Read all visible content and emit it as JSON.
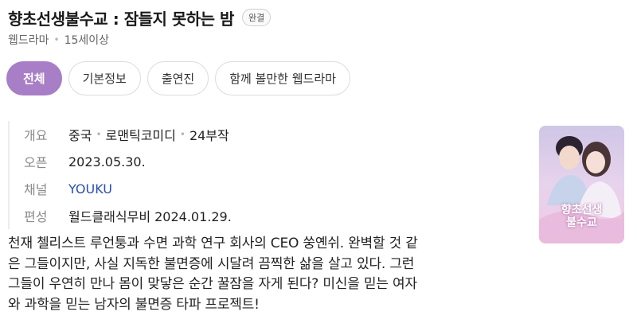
{
  "header": {
    "title": "향초선생불수교 : 잠들지 못하는 밤",
    "badge": "완결",
    "genre": "웹드라마",
    "rating": "15세이상"
  },
  "tabs": [
    {
      "label": "전체",
      "active": true
    },
    {
      "label": "기본정보",
      "active": false
    },
    {
      "label": "출연진",
      "active": false
    },
    {
      "label": "함께 볼만한 웹드라마",
      "active": false
    }
  ],
  "info": {
    "overview_key": "개요",
    "overview_country": "중국",
    "overview_genre": "로맨틱코미디",
    "overview_episodes": "24부작",
    "open_key": "오픈",
    "open_value": "2023.05.30.",
    "channel_key": "채널",
    "channel_value": "YOUKU",
    "format_key": "편성",
    "format_value": "월드클래식무비 2024.01.29."
  },
  "poster": {
    "title_line1": "향초선생",
    "title_line2": "불수교"
  },
  "synopsis": {
    "line1": "천재 첼리스트 루언퉁과 수면 과학 연구 회사의 CEO 쑹옌쉬. 완벽할 것 같",
    "line2": "은 그들이지만, 사실 지독한 불면증에 시달려 끔찍한 삶을 살고 있다. 그런",
    "line3": "그들이 우연히 만나 몸이 맞닿은 순간 꿀잠을 자게 된다? 미신을 믿는 여자",
    "line4": "와 과학을 믿는 남자의 불면증 타파 프로젝트!"
  },
  "colors": {
    "accent": "#a87ec6",
    "link": "#2a4fb5"
  }
}
